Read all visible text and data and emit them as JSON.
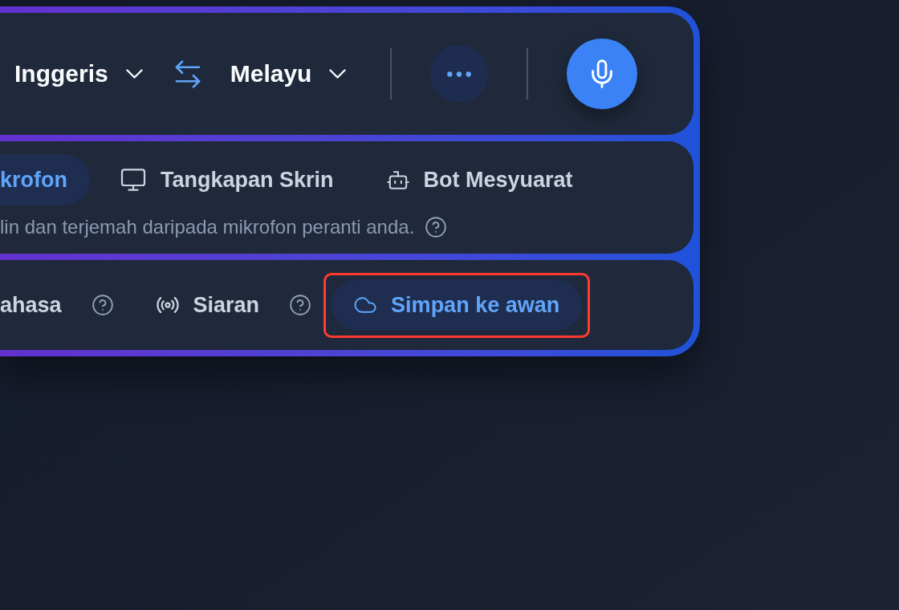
{
  "language_bar": {
    "source_language": "Inggeris",
    "target_language": "Melayu"
  },
  "input_sources": {
    "tabs": [
      {
        "label": "krofon",
        "selected": true
      },
      {
        "label": "Tangkapan Skrin",
        "selected": false
      },
      {
        "label": "Bot Mesyuarat",
        "selected": false
      }
    ],
    "description": "lin dan terjemah daripada mikrofon peranti anda."
  },
  "options": [
    {
      "label": "ahasa",
      "on": false,
      "help": true,
      "highlighted": false
    },
    {
      "label": "Siaran",
      "on": false,
      "help": true,
      "highlighted": false
    },
    {
      "label": "Simpan ke awan",
      "on": true,
      "help": false,
      "highlighted": true
    }
  ]
}
